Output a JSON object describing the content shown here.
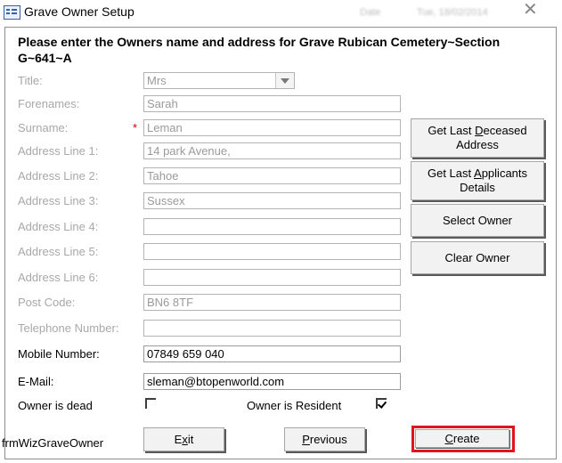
{
  "window": {
    "title": "Grave Owner Setup",
    "close_glyph": "✕",
    "icon": "form-icon",
    "blurred_date_label": "Date",
    "blurred_date_value": "Tue, 18/02/2014"
  },
  "header": {
    "line1": "Please enter the Owners name and address for Grave Rubican Cemetery~Section",
    "line2": "G~641~A"
  },
  "fields": {
    "title": {
      "label": "Title:",
      "value": "Mrs"
    },
    "forenames": {
      "label": "Forenames:",
      "value": "Sarah"
    },
    "surname": {
      "label": "Surname:",
      "value": "Leman",
      "required_mark": "*"
    },
    "address1": {
      "label": "Address Line 1:",
      "value": "14 park Avenue,"
    },
    "address2": {
      "label": "Address Line 2:",
      "value": "Tahoe"
    },
    "address3": {
      "label": "Address Line 3:",
      "value": "Sussex"
    },
    "address4": {
      "label": "Address Line 4:",
      "value": ""
    },
    "address5": {
      "label": "Address Line 5:",
      "value": ""
    },
    "address6": {
      "label": "Address Line 6:",
      "value": ""
    },
    "postcode": {
      "label": "Post Code:",
      "value": "BN6 8TF"
    },
    "telephone": {
      "label": "Telephone Number:",
      "value": ""
    },
    "mobile": {
      "label": "Mobile Number:",
      "value": "07849 659 040"
    },
    "email": {
      "label": "E-Mail:",
      "value": "sleman@btopenworld.com"
    }
  },
  "checkboxes": {
    "owner_dead": {
      "label": "Owner is dead",
      "checked": false
    },
    "owner_resident": {
      "label": "Owner is Resident",
      "checked": true
    }
  },
  "side_buttons": {
    "last_deceased": {
      "pre": "Get Last ",
      "key": "D",
      "post": "eceased",
      "line2": "Address"
    },
    "last_applicants": {
      "pre": "Get Last ",
      "key": "A",
      "post": "pplicants",
      "line2": "Details"
    },
    "select_owner": "Select Owner",
    "clear_owner": "Clear Owner"
  },
  "bottom_buttons": {
    "exit": {
      "pre": "E",
      "key": "x",
      "post": "it"
    },
    "previous": {
      "pre": "",
      "key": "P",
      "post": "revious"
    },
    "create": {
      "pre": "",
      "key": "C",
      "post": "reate"
    }
  },
  "form_name": "frmWizGraveOwner",
  "colors": {
    "highlight": "#e0141c",
    "required": "#d00000",
    "disabled_text": "#a8a8a8"
  }
}
